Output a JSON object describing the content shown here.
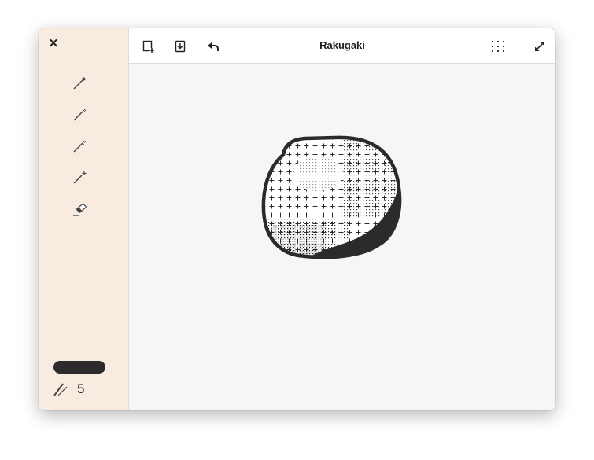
{
  "window": {
    "title": "Rakugaki"
  },
  "sidebar": {
    "close_icon": "close-icon",
    "tools": [
      {
        "name": "pen-tool",
        "icon": "pen-icon"
      },
      {
        "name": "spray-pen-tool",
        "icon": "spray-pen-icon"
      },
      {
        "name": "dotted-pen-tool",
        "icon": "dotted-pen-icon"
      },
      {
        "name": "cross-pen-tool",
        "icon": "cross-pen-icon"
      },
      {
        "name": "eraser-tool",
        "icon": "eraser-icon"
      }
    ],
    "color": "#2d2a2e",
    "size_value": "5"
  },
  "header": {
    "new_icon": "new-canvas-icon",
    "save_icon": "save-icon",
    "undo_icon": "undo-icon",
    "menu_icon": "grid-menu-icon",
    "fullscreen_icon": "fullscreen-icon"
  },
  "colors": {
    "sidebar_bg": "#f8ece0",
    "canvas_bg": "#f6f6f6",
    "ink": "#2d2a2e"
  }
}
